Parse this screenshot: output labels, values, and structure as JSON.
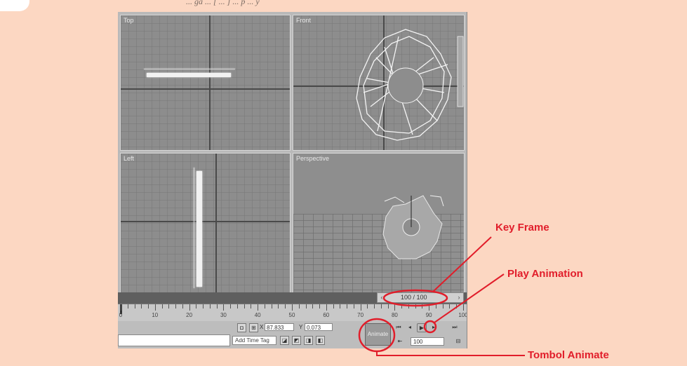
{
  "caption": "... ga ... [ ... ] ... p ... y",
  "viewports": {
    "top_label": "Top",
    "front_label": "Front",
    "left_label": "Left",
    "perspective_label": "Perspective"
  },
  "time_slider": {
    "counter": "100 / 100",
    "prev_arrow": "‹",
    "next_arrow": "›"
  },
  "ruler_ticks": [
    "0",
    "10",
    "20",
    "30",
    "40",
    "50",
    "60",
    "70",
    "80",
    "90",
    "100"
  ],
  "status": {
    "x_label": "X",
    "x_value": "87.833",
    "y_label": "Y",
    "y_value": "0.073",
    "add_time_tag": "Add Time Tag",
    "animate_label": "Animate",
    "frame_value": "100"
  },
  "callouts": {
    "key_frame": "Key Frame",
    "play_animation": "Play Animation",
    "tombol_animate": "Tombol Animate"
  },
  "colors": {
    "page_background": "#fcd7c2",
    "callout_red": "#e11d2a"
  }
}
